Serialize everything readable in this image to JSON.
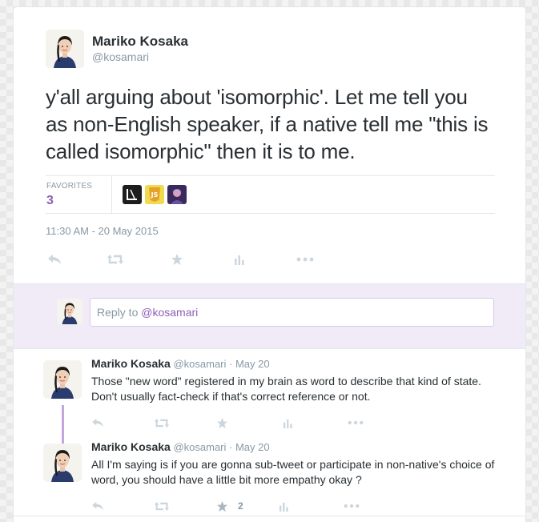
{
  "tweet": {
    "author_name": "Mariko Kosaka",
    "author_handle": "@kosamari",
    "text": "y'all arguing about 'isomorphic'. Let me tell you as non-English speaker, if a native tell me \"this is called isomorphic\" then it is to me.",
    "favorites_label": "FAVORITES",
    "favorites_count": "3",
    "timestamp": "11:30 AM - 20 May 2015",
    "favoriters": [
      "letter-L-avatar",
      "js-logo-avatar",
      "purple-portrait-avatar"
    ],
    "actions": [
      "reply-icon",
      "retweet-icon",
      "favorite-star-icon",
      "analytics-icon",
      "more-icon"
    ]
  },
  "reply_box": {
    "placeholder_prefix": "Reply to ",
    "placeholder_mention": "@kosamari"
  },
  "replies": [
    {
      "name": "Mariko Kosaka",
      "handle": "@kosamari",
      "date": "· May 20",
      "text": "Those \"new word\" registered in my brain as word to describe that kind of state. Don't usually fact-check if that's correct reference or not.",
      "favorite_count": ""
    },
    {
      "name": "Mariko Kosaka",
      "handle": "@kosamari",
      "date": "· May 20",
      "text": "All I'm saying is if you are gonna sub-tweet or participate in non-native's choice of word, you should have a little bit more empathy okay ?",
      "favorite_count": "2"
    }
  ],
  "colors": {
    "accent": "#8d5fb5",
    "reply_bg": "#f1ebf8",
    "thread_line": "#c3a6de",
    "icon_gray": "#ccd6dd"
  }
}
